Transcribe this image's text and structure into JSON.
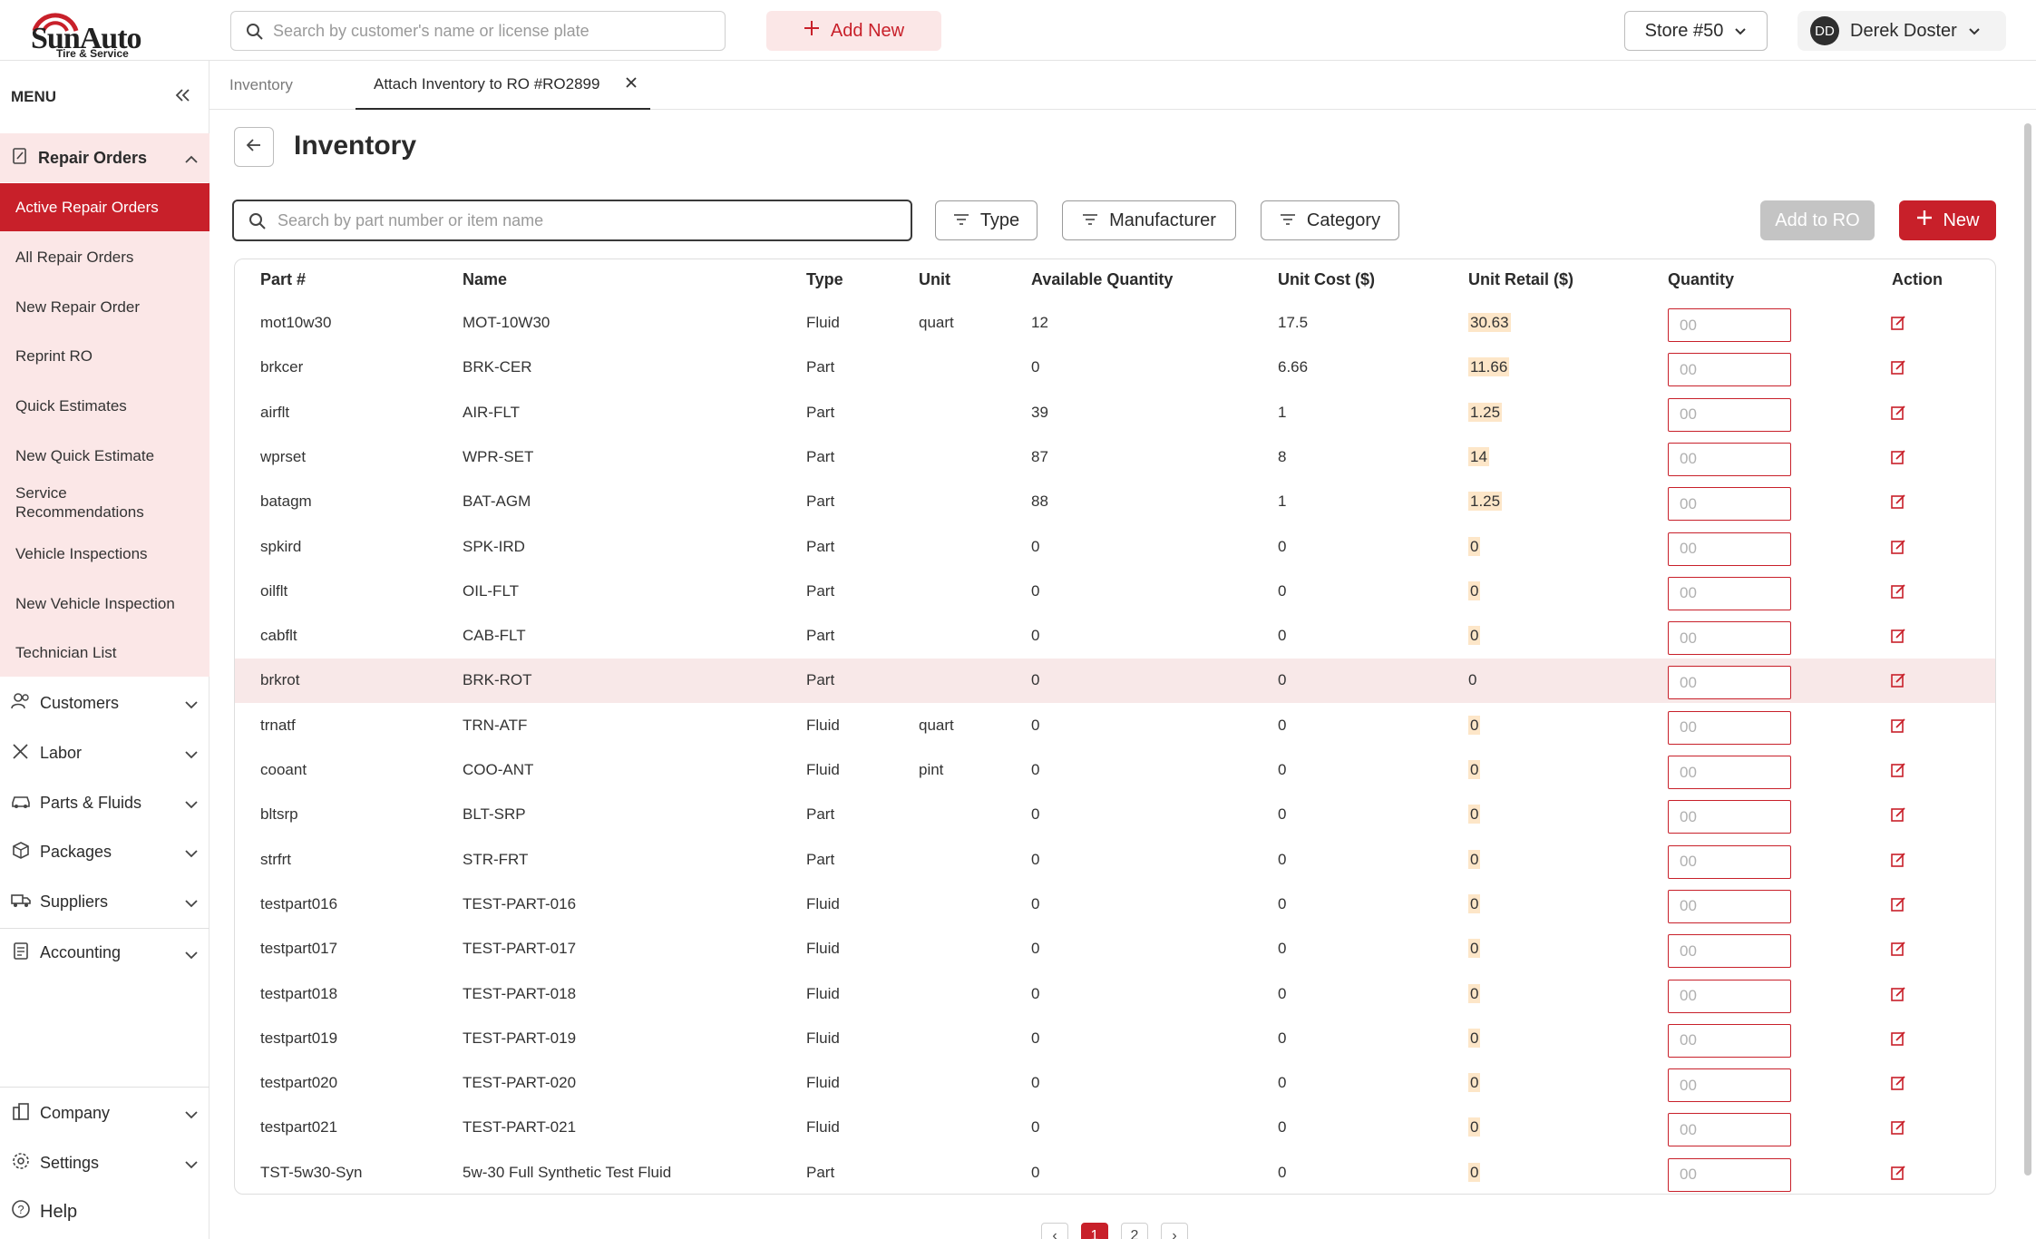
{
  "brand": {
    "logo_text": "SunAuto",
    "logo_sub": "Tire & Service",
    "accent": "#c8202a"
  },
  "header": {
    "search_placeholder": "Search by customer's name or license plate",
    "add_new": "Add New",
    "store": "Store #50",
    "user_initials": "DD",
    "user_name": "Derek Doster"
  },
  "sidebar": {
    "menu_label": "MENU",
    "repair_orders": "Repair Orders",
    "sub_items": [
      "Active Repair Orders",
      "All Repair Orders",
      "New Repair Order",
      "Reprint RO",
      "Quick Estimates",
      "New Quick Estimate",
      "Service Recommendations",
      "Vehicle Inspections",
      "New Vehicle Inspection",
      "Technician List"
    ],
    "groups": [
      "Customers",
      "Labor",
      "Parts & Fluids",
      "Packages",
      "Suppliers",
      "Accounting"
    ],
    "bottom": [
      "Company",
      "Settings"
    ],
    "help": "Help"
  },
  "tabs": [
    "Inventory",
    "Attach Inventory to RO #RO2899"
  ],
  "page": {
    "title": "Inventory",
    "search_placeholder": "Search by part number or item name"
  },
  "filters": [
    "Type",
    "Manufacturer",
    "Category"
  ],
  "actions": {
    "add_to_ro": "Add to RO",
    "new": "New"
  },
  "table": {
    "columns": [
      "Part #",
      "Name",
      "Type",
      "Unit",
      "Available Quantity",
      "Unit Cost ($)",
      "Unit Retail ($)",
      "Quantity",
      "Action"
    ],
    "qty_placeholder": "00",
    "rows": [
      [
        "mot10w30",
        "MOT-10W30",
        "Fluid",
        "quart",
        "12",
        "17.5",
        "30.63"
      ],
      [
        "brkcer",
        "BRK-CER",
        "Part",
        "",
        "0",
        "6.66",
        "11.66"
      ],
      [
        "airflt",
        "AIR-FLT",
        "Part",
        "",
        "39",
        "1",
        "1.25"
      ],
      [
        "wprset",
        "WPR-SET",
        "Part",
        "",
        "87",
        "8",
        "14"
      ],
      [
        "batagm",
        "BAT-AGM",
        "Part",
        "",
        "88",
        "1",
        "1.25"
      ],
      [
        "spkird",
        "SPK-IRD",
        "Part",
        "",
        "0",
        "0",
        "0"
      ],
      [
        "oilflt",
        "OIL-FLT",
        "Part",
        "",
        "0",
        "0",
        "0"
      ],
      [
        "cabflt",
        "CAB-FLT",
        "Part",
        "",
        "0",
        "0",
        "0"
      ],
      [
        "brkrot",
        "BRK-ROT",
        "Part",
        "",
        "0",
        "0",
        "0"
      ],
      [
        "trnatf",
        "TRN-ATF",
        "Fluid",
        "quart",
        "0",
        "0",
        "0"
      ],
      [
        "cooant",
        "COO-ANT",
        "Fluid",
        "pint",
        "0",
        "0",
        "0"
      ],
      [
        "bltsrp",
        "BLT-SRP",
        "Part",
        "",
        "0",
        "0",
        "0"
      ],
      [
        "strfrt",
        "STR-FRT",
        "Part",
        "",
        "0",
        "0",
        "0"
      ],
      [
        "testpart016",
        "TEST-PART-016",
        "Fluid",
        "",
        "0",
        "0",
        "0"
      ],
      [
        "testpart017",
        "TEST-PART-017",
        "Fluid",
        "",
        "0",
        "0",
        "0"
      ],
      [
        "testpart018",
        "TEST-PART-018",
        "Fluid",
        "",
        "0",
        "0",
        "0"
      ],
      [
        "testpart019",
        "TEST-PART-019",
        "Fluid",
        "",
        "0",
        "0",
        "0"
      ],
      [
        "testpart020",
        "TEST-PART-020",
        "Fluid",
        "",
        "0",
        "0",
        "0"
      ],
      [
        "testpart021",
        "TEST-PART-021",
        "Fluid",
        "",
        "0",
        "0",
        "0"
      ],
      [
        "TST-5w30-Syn",
        "5w-30 Full Synthetic Test Fluid",
        "Part",
        "",
        "0",
        "0",
        "0"
      ]
    ]
  },
  "pagination": {
    "prev": "‹",
    "pages": [
      "1",
      "2"
    ],
    "next": "›",
    "current": "1"
  }
}
